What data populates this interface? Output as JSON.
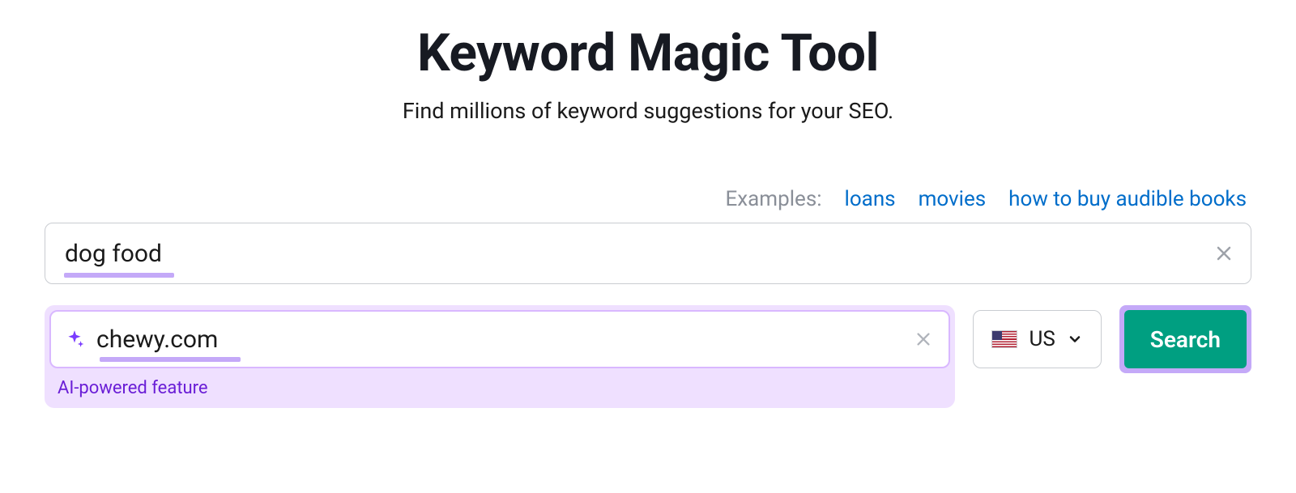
{
  "header": {
    "title": "Keyword Magic Tool",
    "subtitle": "Find millions of keyword suggestions for your SEO."
  },
  "examples": {
    "label": "Examples:",
    "items": [
      "loans",
      "movies",
      "how to buy audible books"
    ]
  },
  "keyword_input": {
    "value": "dog food"
  },
  "domain_input": {
    "value": "chewy.com",
    "ai_label": "AI-powered feature"
  },
  "country": {
    "code": "US"
  },
  "search": {
    "label": "Search"
  }
}
